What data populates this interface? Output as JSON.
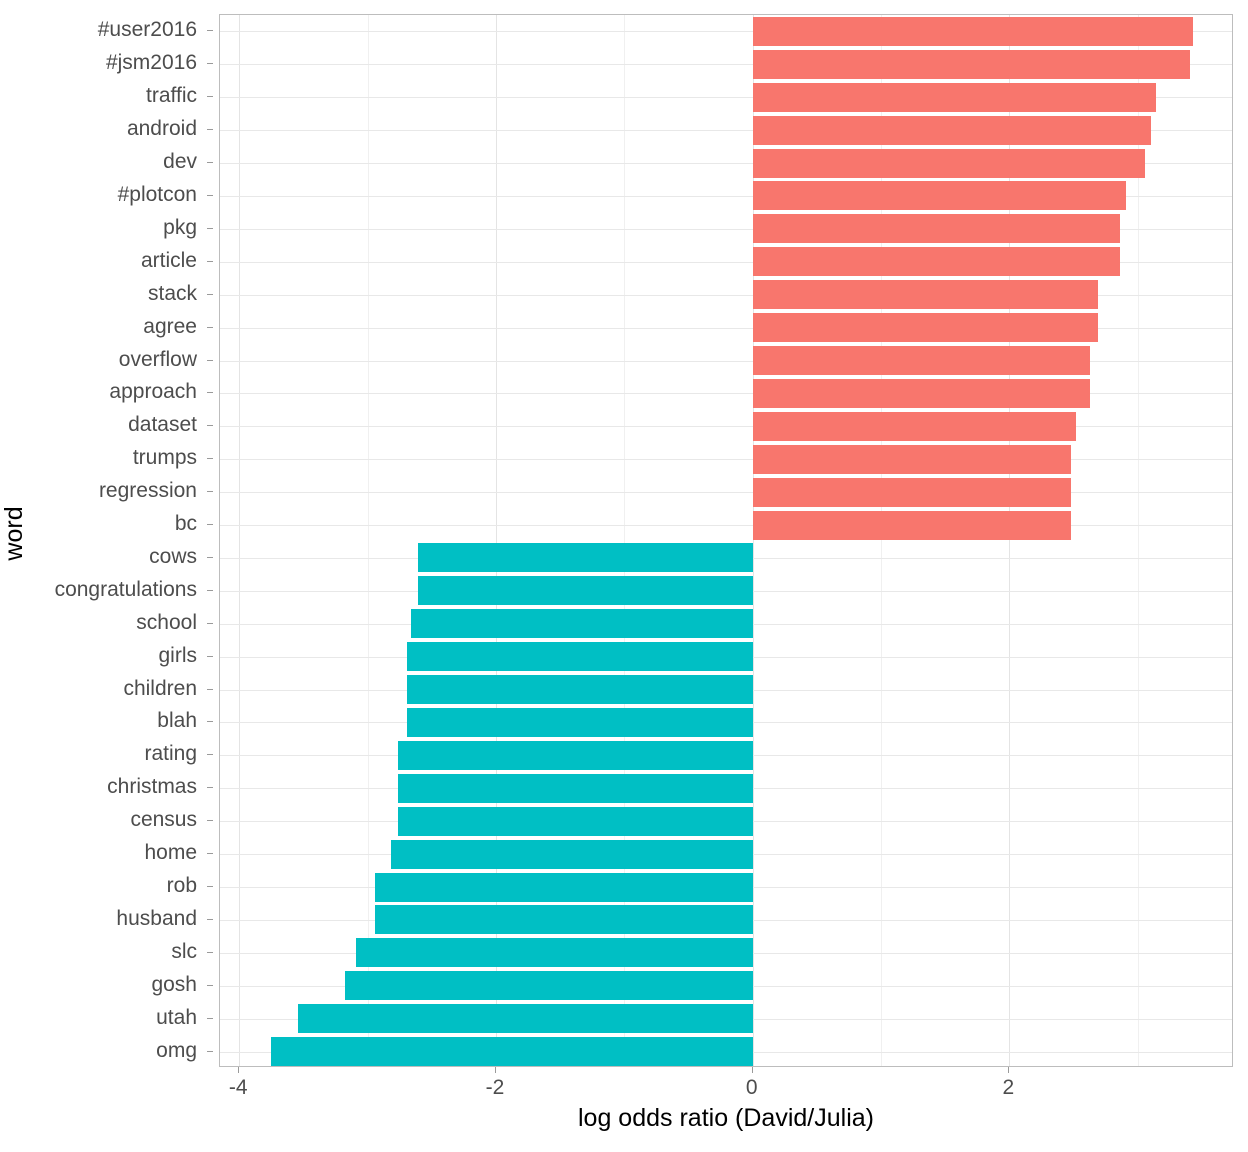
{
  "chart_data": {
    "type": "bar",
    "orientation": "horizontal",
    "title": "",
    "xlabel": "log odds ratio (David/Julia)",
    "ylabel": "word",
    "xlim": [
      -4.15,
      3.75
    ],
    "ylim_categories": 32,
    "grid": true,
    "legend": "none",
    "x_ticks": [
      -4,
      -2,
      0,
      2
    ],
    "x_tick_labels": [
      "-4",
      "-2",
      "0",
      "2"
    ],
    "x_minor_ticks": [
      -3,
      -1,
      1,
      3
    ],
    "colors": {
      "positive": "#F8766D",
      "negative": "#00BFC4",
      "panel_background": "#FFFFFF",
      "grid_major": "#E4E4E4",
      "panel_border": "#BDBDBD",
      "tick_label": "#4D4D4D",
      "axis_title": "#000000"
    },
    "categories": [
      "#user2016",
      "#jsm2016",
      "traffic",
      "android",
      "dev",
      "#plotcon",
      "pkg",
      "article",
      "stack",
      "agree",
      "overflow",
      "approach",
      "dataset",
      "trumps",
      "regression",
      "bc",
      "cows",
      "congratulations",
      "school",
      "girls",
      "children",
      "blah",
      "rating",
      "christmas",
      "census",
      "home",
      "rob",
      "husband",
      "slc",
      "gosh",
      "utah",
      "omg"
    ],
    "values": [
      3.43,
      3.41,
      3.14,
      3.1,
      3.06,
      2.91,
      2.86,
      2.86,
      2.69,
      2.69,
      2.63,
      2.63,
      2.52,
      2.48,
      2.48,
      2.48,
      -2.61,
      -2.61,
      -2.66,
      -2.69,
      -2.69,
      -2.69,
      -2.76,
      -2.76,
      -2.76,
      -2.82,
      -2.94,
      -2.94,
      -3.09,
      -3.18,
      -3.54,
      -3.75
    ]
  }
}
